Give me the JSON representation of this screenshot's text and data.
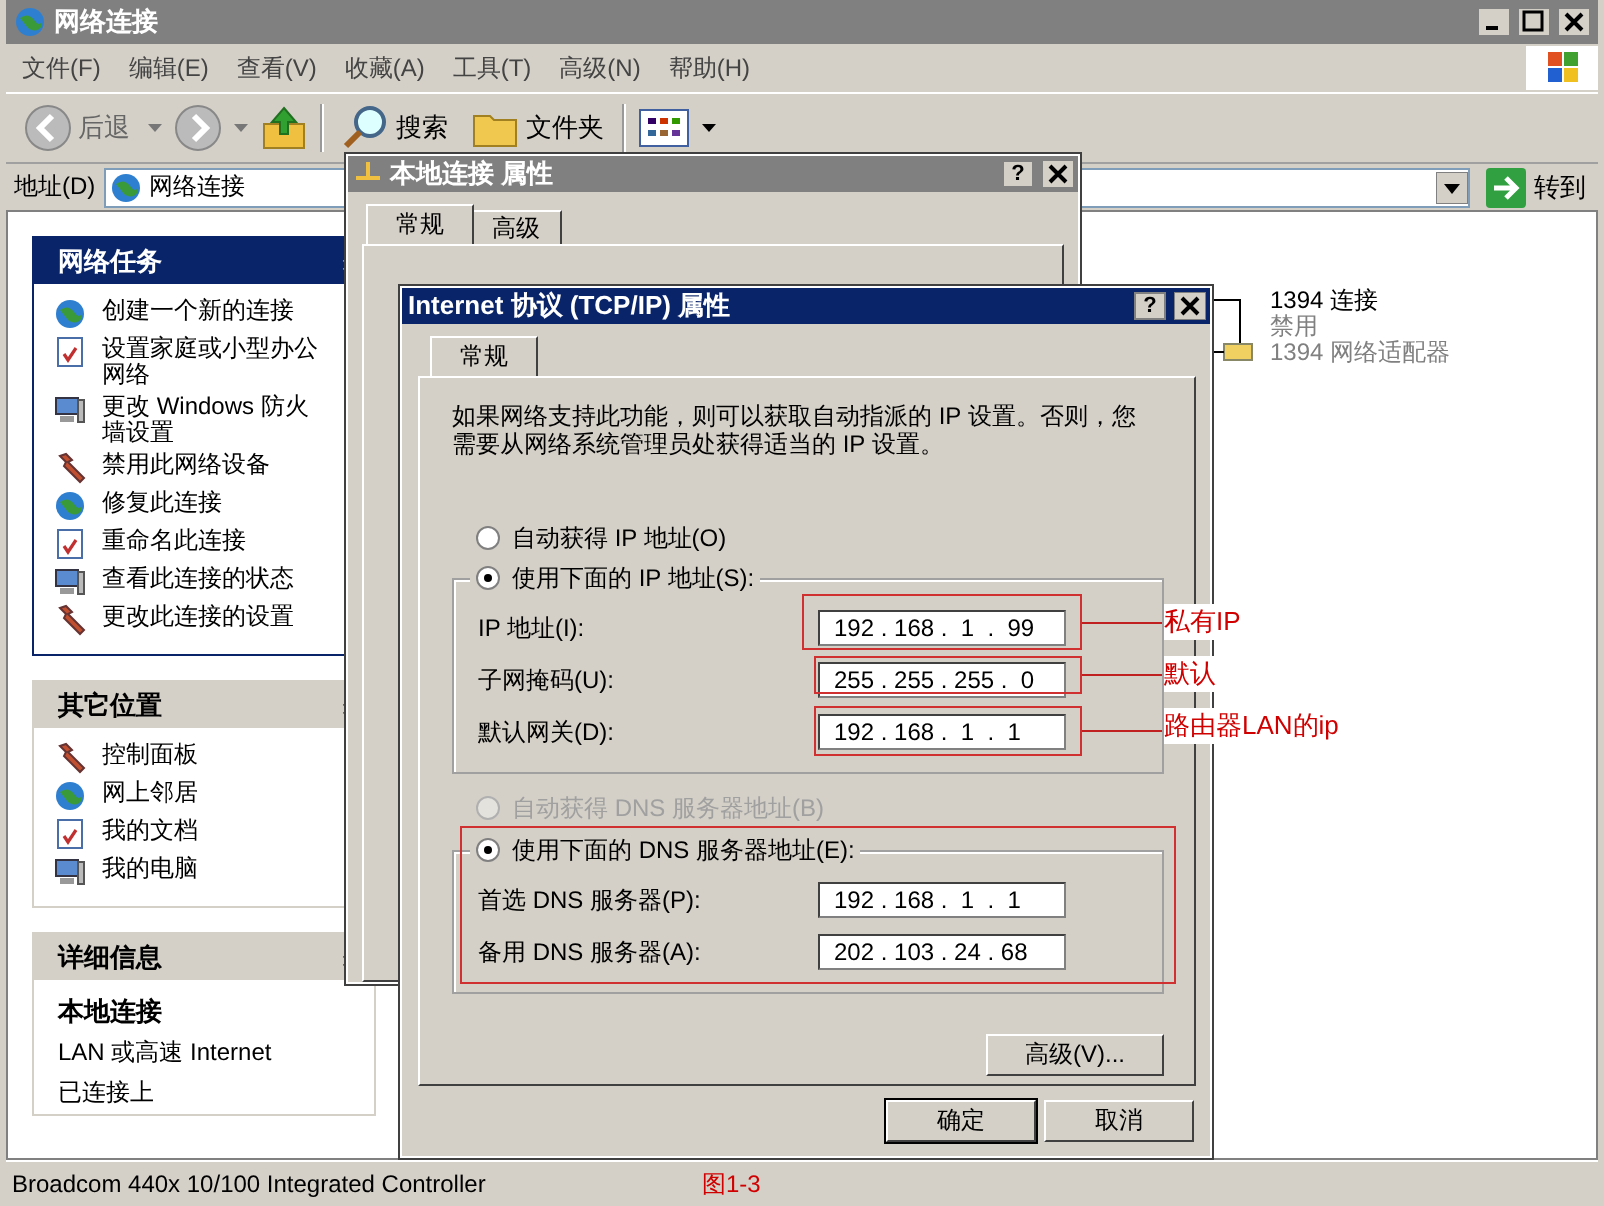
{
  "window": {
    "title": "网络连接"
  },
  "menu": [
    "文件(F)",
    "编辑(E)",
    "查看(V)",
    "收藏(A)",
    "工具(T)",
    "高级(N)",
    "帮助(H)"
  ],
  "toolbar": {
    "back": "后退",
    "search": "搜索",
    "folders": "文件夹"
  },
  "address": {
    "label": "地址(D)",
    "value": "网络连接",
    "go": "转到"
  },
  "sidebar": [
    {
      "title": "网络任务",
      "kind": "primary",
      "items": [
        "创建一个新的连接",
        "设置家庭或小型办公网络",
        "更改 Windows 防火墙设置",
        "禁用此网络设备",
        "修复此连接",
        "重命名此连接",
        "查看此连接的状态",
        "更改此连接的设置"
      ]
    },
    {
      "title": "其它位置",
      "kind": "secondary",
      "items": [
        "控制面板",
        "网上邻居",
        "我的文档",
        "我的电脑"
      ]
    }
  ],
  "details": {
    "title": "详细信息",
    "name": "本地连接",
    "lines": [
      "LAN 或高速 Internet",
      "已连接上"
    ]
  },
  "connections": [
    {
      "name": "1394 连接",
      "status": "禁用",
      "device": "1394 网络适配器"
    }
  ],
  "local_dialog": {
    "title": "本地连接 属性",
    "help": "?",
    "tabs": [
      {
        "label": "常规",
        "selected": true
      },
      {
        "label": "高级",
        "selected": false
      }
    ]
  },
  "tcpip_dialog": {
    "title": "Internet 协议 (TCP/IP) 属性",
    "help": "?",
    "tabs": [
      {
        "label": "常规",
        "selected": true
      }
    ],
    "description": "如果网络支持此功能，则可以获取自动指派的 IP 设置。否则，您需要从网络系统管理员处获得适当的 IP 设置。",
    "ip_mode": [
      {
        "label": "自动获得 IP 地址(O)",
        "selected": false
      },
      {
        "label": "使用下面的 IP 地址(S):",
        "selected": true
      }
    ],
    "ip_fields": [
      {
        "label": "IP 地址(I):",
        "value": "192 . 168 .  1  .  99"
      },
      {
        "label": "子网掩码(U):",
        "value": "255 . 255 . 255 .  0"
      },
      {
        "label": "默认网关(D):",
        "value": "192 . 168 .  1  .  1"
      }
    ],
    "dns_mode": [
      {
        "label": "自动获得 DNS 服务器地址(B)",
        "selected": false,
        "disabled": true
      },
      {
        "label": "使用下面的 DNS 服务器地址(E):",
        "selected": true
      }
    ],
    "dns_fields": [
      {
        "label": "首选 DNS 服务器(P):",
        "value": "192 . 168 .  1  .  1"
      },
      {
        "label": "备用 DNS 服务器(A):",
        "value": "202 . 103 . 24 . 68"
      }
    ],
    "advanced_button": "高级(V)...",
    "buttons": [
      "确定",
      "取消"
    ]
  },
  "annotations": [
    {
      "label": "私有IP"
    },
    {
      "label": "默认"
    },
    {
      "label": "路由器LAN的ip"
    }
  ],
  "status_bar": {
    "text": "Broadcom 440x 10/100 Integrated Controller",
    "figure": "图1-3"
  }
}
